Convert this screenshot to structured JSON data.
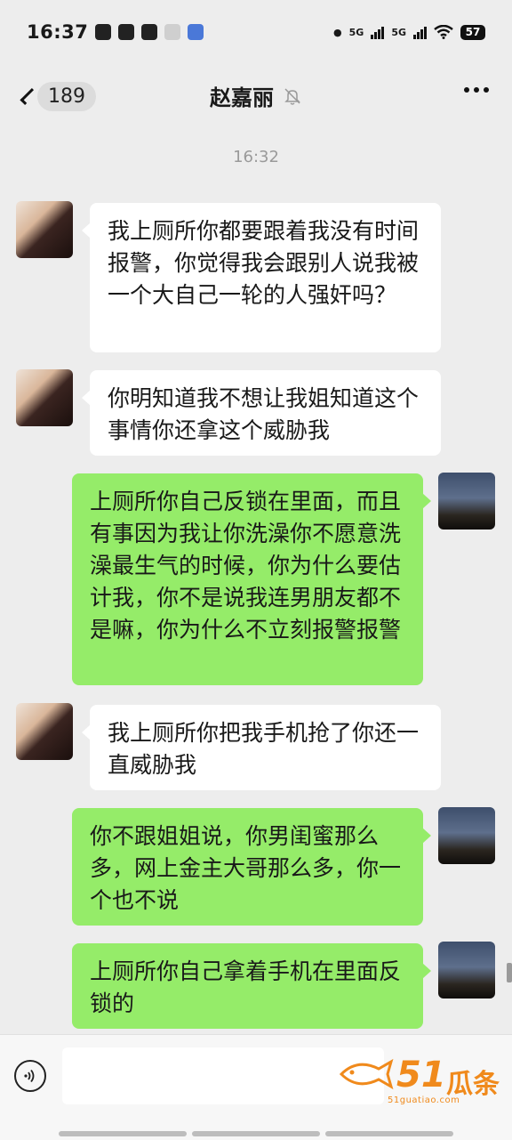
{
  "status_bar": {
    "time": "16:37",
    "network_1": "5G",
    "network_2": "5G",
    "battery": "57"
  },
  "navbar": {
    "back_badge": "189",
    "title": "赵嘉丽",
    "title_icon": "bell-off-icon",
    "more_icon": "more-icon"
  },
  "chat": {
    "timestamp": "16:32",
    "messages": [
      {
        "side": "left",
        "text": "我上厕所你都要跟着我没有时间报警，你觉得我会跟别人说我被一个大自己一轮的人强奸吗？"
      },
      {
        "side": "left",
        "text": "你明知道我不想让我姐知道这个事情你还拿这个威胁我"
      },
      {
        "side": "right",
        "text": "上厕所你自己反锁在里面，而且有事因为我让你洗澡你不愿意洗澡最生气的时候，你为什么要估计我，你不是说我连男朋友都不是嘛，你为什么不立刻报警报警"
      },
      {
        "side": "left",
        "text": "我上厕所你把我手机抢了你还一直威胁我"
      },
      {
        "side": "right",
        "text": "你不跟姐姐说，你男闺蜜那么多，网上金主大哥那么多，你一个也不说"
      },
      {
        "side": "right",
        "text": "上厕所你自己拿着手机在里面反锁的"
      }
    ]
  },
  "input_bar": {
    "voice_icon": "voice-icon",
    "placeholder": "",
    "watermark_number": "51",
    "watermark_text": "瓜条",
    "watermark_url": "51guatiao.com"
  },
  "colors": {
    "background": "#ededed",
    "bubble_self": "#95ec69",
    "bubble_other": "#ffffff",
    "watermark": "#f08a1c"
  }
}
